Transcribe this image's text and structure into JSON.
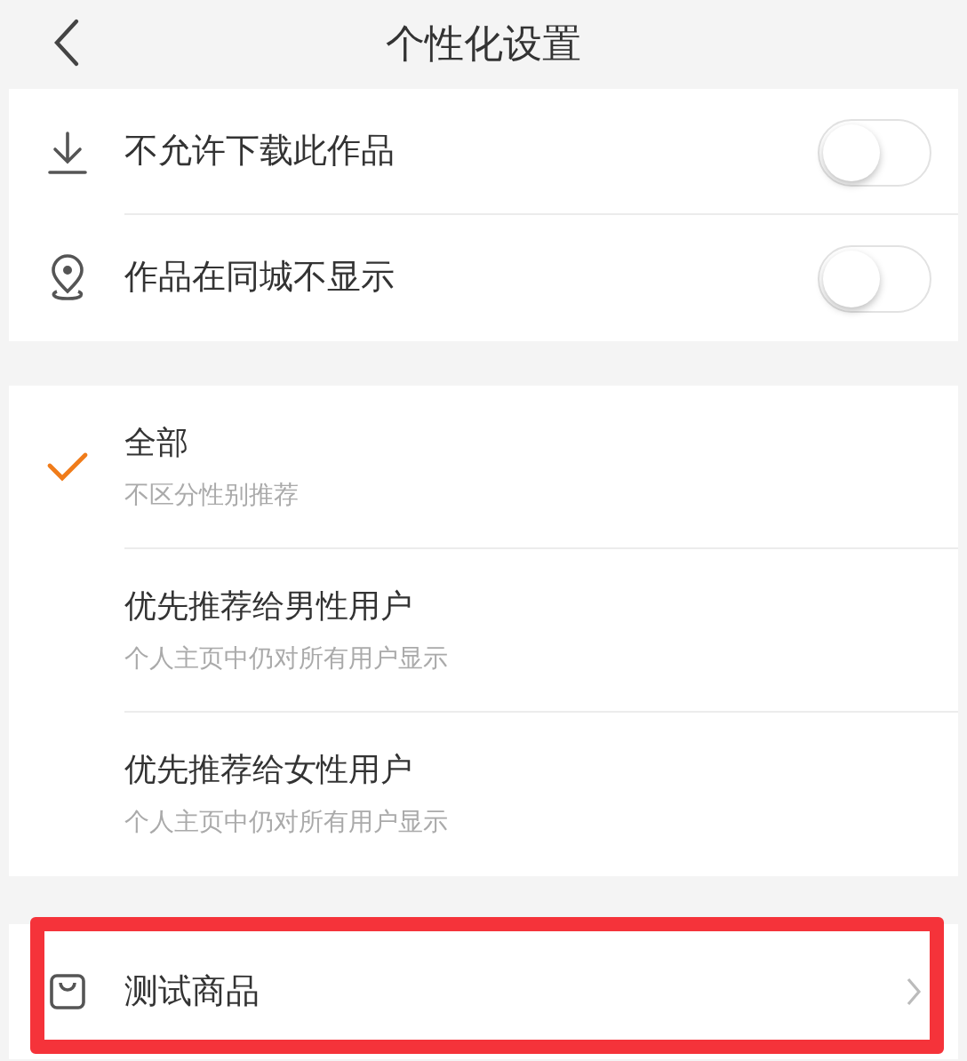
{
  "header": {
    "title": "个性化设置"
  },
  "toggles": [
    {
      "kind": "download",
      "label": "不允许下载此作品",
      "on": false
    },
    {
      "kind": "location",
      "label": "作品在同城不显示",
      "on": false
    }
  ],
  "audience": [
    {
      "title": "全部",
      "subtitle": "不区分性别推荐",
      "selected": true
    },
    {
      "title": "优先推荐给男性用户",
      "subtitle": "个人主页中仍对所有用户显示",
      "selected": false
    },
    {
      "title": "优先推荐给女性用户",
      "subtitle": "个人主页中仍对所有用户显示",
      "selected": false
    }
  ],
  "product": {
    "label": "测试商品",
    "highlighted": true
  }
}
